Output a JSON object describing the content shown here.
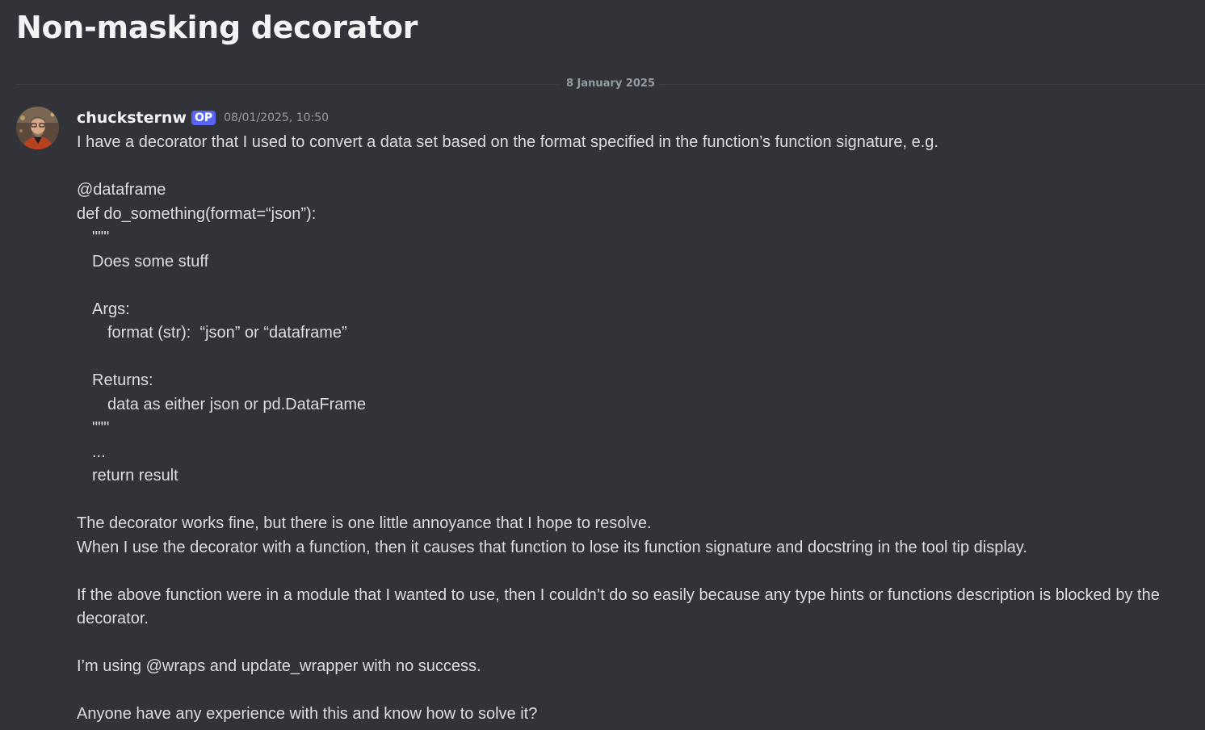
{
  "thread": {
    "title": "Non-masking decorator"
  },
  "divider": {
    "date": "8 January 2025"
  },
  "message": {
    "author": "chucksternw",
    "badge": "OP",
    "timestamp": "08/01/2025, 10:50",
    "lines": [
      "I have a decorator that I used to convert a data set based on the format specified in the function’s function signature, e.g.",
      "",
      "@dataframe",
      "def do_something(format=“json”):",
      "\"\"\"",
      "Does some stuff",
      "",
      "Args:",
      "format (str):  “json” or “dataframe”",
      "",
      "Returns:",
      "data as either json or pd.DataFrame",
      "\"\"\"",
      "...",
      "return result",
      "",
      "The decorator works fine, but there is one little annoyance that I hope to resolve.",
      "When I use the decorator with a function, then it causes that function to lose its function signature and docstring in the tool tip display.",
      "",
      "If the above function were in a module that I wanted to use, then I couldn’t do so easily because any type hints or functions description is blocked by the decorator.",
      "",
      "I’m using @wraps  and update_wrapper with no success.",
      "",
      "Anyone have any experience with this and know how to solve it?"
    ]
  },
  "colors": {
    "background": "#313338",
    "text": "#dbdee1",
    "title": "#f2f3f5",
    "muted": "#949ba4",
    "badge": "#5865f2"
  }
}
